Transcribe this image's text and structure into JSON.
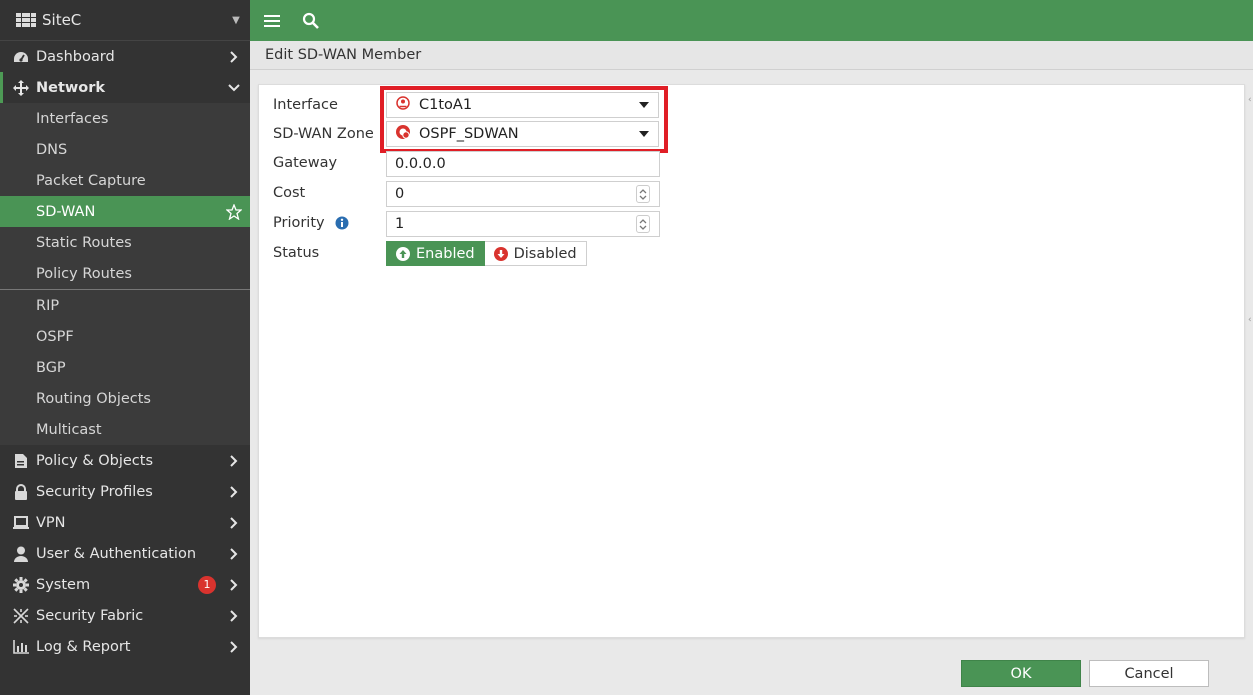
{
  "sidebar": {
    "site_name": "SiteC",
    "items": [
      {
        "label": "Dashboard"
      },
      {
        "label": "Network"
      },
      {
        "label": "Policy & Objects"
      },
      {
        "label": "Security Profiles"
      },
      {
        "label": "VPN"
      },
      {
        "label": "User & Authentication"
      },
      {
        "label": "System",
        "badge": "1"
      },
      {
        "label": "Security Fabric"
      },
      {
        "label": "Log & Report"
      }
    ],
    "network_sub": [
      "Interfaces",
      "DNS",
      "Packet Capture",
      "SD-WAN",
      "Static Routes",
      "Policy Routes",
      "RIP",
      "OSPF",
      "BGP",
      "Routing Objects",
      "Multicast"
    ]
  },
  "page": {
    "title": "Edit SD-WAN Member"
  },
  "form": {
    "interface_label": "Interface",
    "interface_value": "C1toA1",
    "zone_label": "SD-WAN Zone",
    "zone_value": "OSPF_SDWAN",
    "gateway_label": "Gateway",
    "gateway_value": "0.0.0.0",
    "cost_label": "Cost",
    "cost_value": "0",
    "priority_label": "Priority",
    "priority_value": "1",
    "status_label": "Status",
    "status_enabled": "Enabled",
    "status_disabled": "Disabled"
  },
  "footer": {
    "ok_label": "OK",
    "cancel_label": "Cancel"
  },
  "colors": {
    "brand_green": "#4a9455",
    "sidebar_bg": "#333333",
    "highlight_red": "#e01e26",
    "badge_red": "#d9332e"
  }
}
